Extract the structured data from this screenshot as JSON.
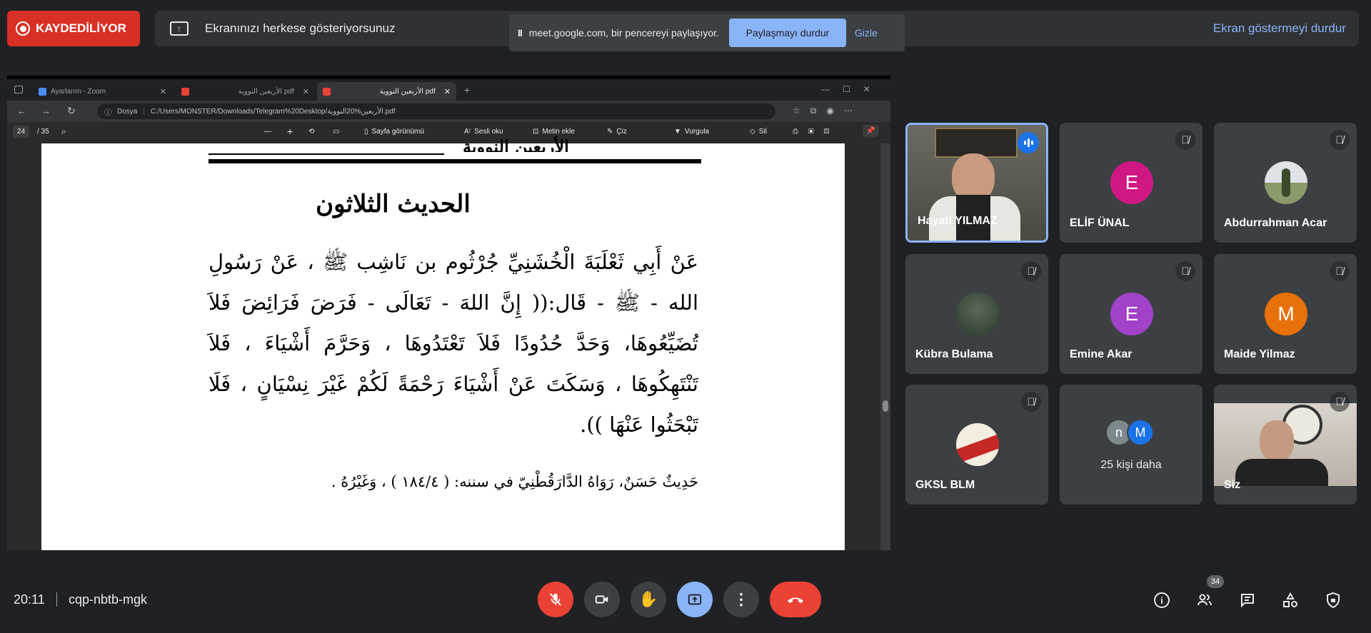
{
  "recording": {
    "label": "KAYDEDİLİYOR"
  },
  "presenting": {
    "message": "Ekranınızı herkese gösteriyorsunuz",
    "stop_label": "Ekran göstermeyi durdur"
  },
  "chrome_share": {
    "pause_glyph": "II",
    "message": "meet.google.com, bir pencereyi paylaşıyor.",
    "stop_button": "Paylaşmayı durdur",
    "hide_button": "Gizle"
  },
  "shared_browser": {
    "tabs": [
      {
        "title": "Ayarlarım - Zoom",
        "icon": "zoom-icon",
        "active": false
      },
      {
        "title": "الأربعين النووية pdf",
        "icon": "pdf-icon",
        "active": false
      },
      {
        "title": "الأربعين النووية pdf",
        "icon": "pdf-icon",
        "active": true
      }
    ],
    "address_label": "Dosya",
    "address_url": "C:/Users/MONSTER/Downloads/Telegram%20Desktop/الأربعين%20النووية.pdf",
    "pdf_toolbar": {
      "page_current": "24",
      "page_total": "/ 35",
      "minus": "—",
      "plus": "+",
      "page_view": "Sayfa görünümü",
      "read_aloud": "Sesli oku",
      "add_text": "Metin ekle",
      "draw": "Çiz",
      "highlight": "Vurgula",
      "erase": "Sil"
    },
    "pdf_page": {
      "header": "الأربعين النووية",
      "title": "الحديث الثلاثون",
      "body": "عَنْ أَبِي ثَعْلَبَةَ الْخُشَنِيِّ جُرْثُوم بن نَاشِب ﷺ ، عَنْ رَسُولِ الله - ﷺ - قَال:(( إِنَّ اللهَ - تَعَالَى - فَرَضَ فَرَائِضَ فَلاَ تُضَيِّعُوهَا، وَحَدَّ حُدُودًا فَلاَ تَعْتَدُوهَا ، وَحَرَّمَ أَشْيَاءَ ، فَلاَ تَنْتَهِكُوهَا ، وَسَكَتَ عَنْ أَشْيَاءَ رَحْمَةً لَكُمْ غَيْرَ نِسْيَانٍ ، فَلَا تَبْحَثُوا عَنْهَا )).",
      "source": "حَدِيثٌ حَسَنٌ، رَوَاهُ الدَّارَقُطْنِيّ في سننه: ( ١٨٤/٤ ) ، وَغَيْرُهُ ."
    }
  },
  "participants": [
    {
      "name": "Hayati YILMAZ",
      "kind": "video",
      "speaking": true,
      "muted": false
    },
    {
      "name": "ELİF ÜNAL",
      "kind": "letter",
      "letter": "E",
      "color": "#d01884",
      "muted": true
    },
    {
      "name": "Abdurrahman Acar",
      "kind": "photo",
      "muted": true
    },
    {
      "name": "Kübra Bulama",
      "kind": "photo",
      "muted": true
    },
    {
      "name": "Emine Akar",
      "kind": "letter",
      "letter": "E",
      "color": "#a142c8",
      "muted": true
    },
    {
      "name": "Maide Yilmaz",
      "kind": "letter",
      "letter": "M",
      "color": "#e8710a",
      "muted": true
    },
    {
      "name": "GKSL BLM",
      "kind": "photo",
      "muted": true
    },
    {
      "name": "",
      "kind": "more",
      "more_text": "25 kişi daha",
      "letters": [
        "n",
        "M"
      ],
      "muted": false
    },
    {
      "name": "Siz",
      "kind": "video",
      "muted": true
    }
  ],
  "meeting": {
    "time": "20:11",
    "code": "cqp-nbtb-mgk",
    "people_count": "34"
  },
  "colors": {
    "background": "#202124",
    "tile": "#3c4043",
    "accent_blue": "#8ab4f8",
    "danger_red": "#ea4335",
    "recording_red": "#d93025"
  }
}
